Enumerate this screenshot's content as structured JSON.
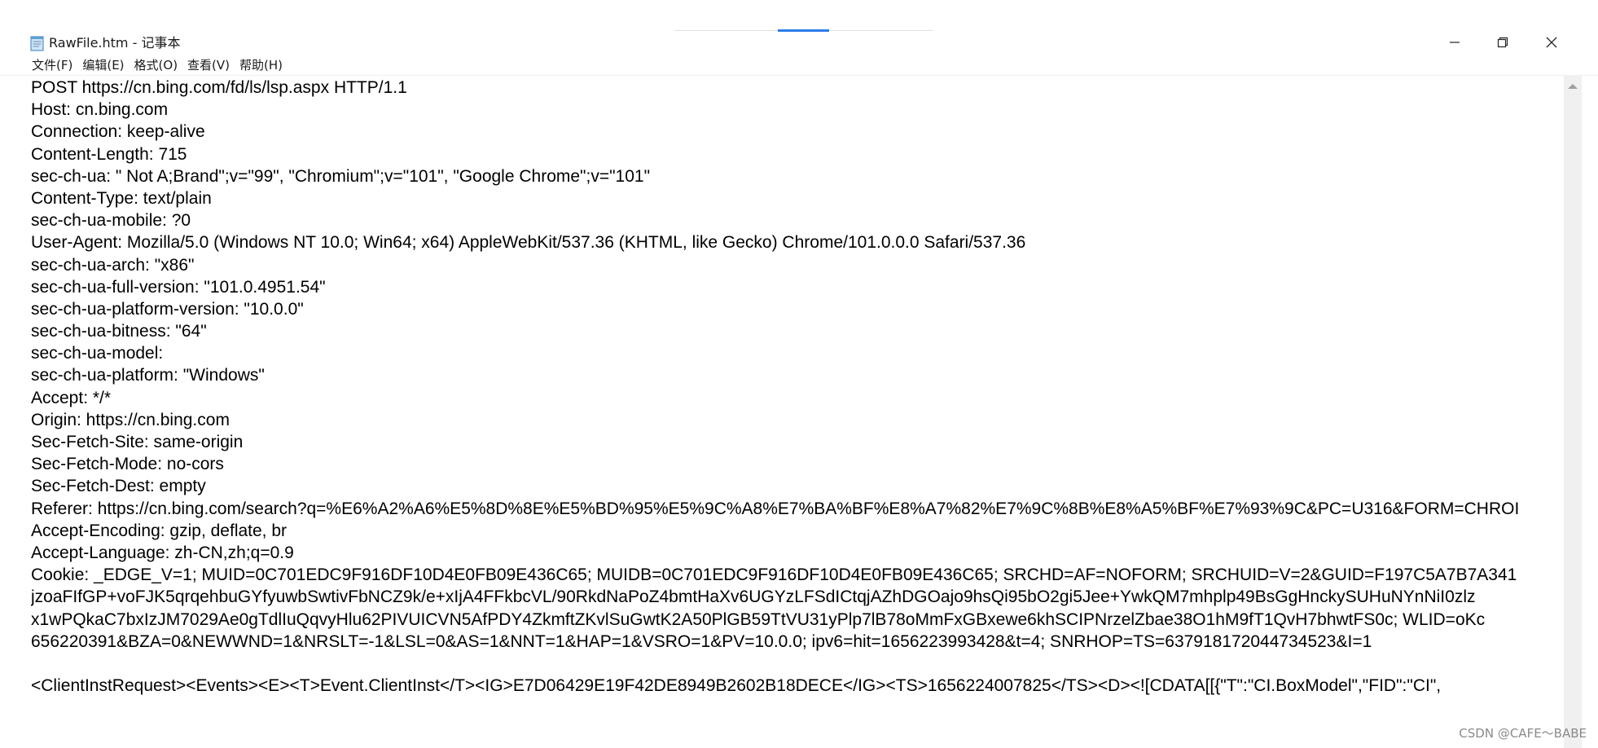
{
  "window": {
    "title": "RawFile.htm - 记事本",
    "icon": "notepad-icon"
  },
  "controls": {
    "minimize_icon": "minimize-icon",
    "maximize_icon": "restore-icon",
    "close_icon": "close-icon"
  },
  "menu": {
    "items": [
      {
        "label": "文件(F)"
      },
      {
        "label": "编辑(E)"
      },
      {
        "label": "格式(O)"
      },
      {
        "label": "查看(V)"
      },
      {
        "label": "帮助(H)"
      }
    ]
  },
  "document": {
    "lines": [
      "POST https://cn.bing.com/fd/ls/lsp.aspx HTTP/1.1",
      "Host: cn.bing.com",
      "Connection: keep-alive",
      "Content-Length: 715",
      "sec-ch-ua: \" Not A;Brand\";v=\"99\", \"Chromium\";v=\"101\", \"Google Chrome\";v=\"101\"",
      "Content-Type: text/plain",
      "sec-ch-ua-mobile: ?0",
      "User-Agent: Mozilla/5.0 (Windows NT 10.0; Win64; x64) AppleWebKit/537.36 (KHTML, like Gecko) Chrome/101.0.0.0 Safari/537.36",
      "sec-ch-ua-arch: \"x86\"",
      "sec-ch-ua-full-version: \"101.0.4951.54\"",
      "sec-ch-ua-platform-version: \"10.0.0\"",
      "sec-ch-ua-bitness: \"64\"",
      "sec-ch-ua-model:",
      "sec-ch-ua-platform: \"Windows\"",
      "Accept: */*",
      "Origin: https://cn.bing.com",
      "Sec-Fetch-Site: same-origin",
      "Sec-Fetch-Mode: no-cors",
      "Sec-Fetch-Dest: empty",
      "Referer: https://cn.bing.com/search?q=%E6%A2%A6%E5%8D%8E%E5%BD%95%E5%9C%A8%E7%BA%BF%E8%A7%82%E7%9C%8B%E8%A5%BF%E7%93%9C&PC=U316&FORM=CHROI",
      "Accept-Encoding: gzip, deflate, br",
      "Accept-Language: zh-CN,zh;q=0.9",
      "Cookie: _EDGE_V=1; MUID=0C701EDC9F916DF10D4E0FB09E436C65; MUIDB=0C701EDC9F916DF10D4E0FB09E436C65; SRCHD=AF=NOFORM; SRCHUID=V=2&GUID=F197C5A7B7A341",
      "jzoaFIfGP+voFJK5qrqehbuGYfyuwbSwtivFbNCZ9k/e+xIjA4FFkbcVL/90RkdNaPoZ4bmtHaXv6UGYzLFSdICtqjAZhDGOajo9hsQi95bO2gi5Jee+YwkQM7mhplp49BsGgHnckySUHuNYnNiI0zlz",
      "x1wPQkaC7bxIzJM7029Ae0gTdlIuQqvyHlu62PIVUICVN5AfPDY4ZkmftZKvlSuGwtK2A50PlGB59TtVU31yPlp7lB78oMmFxGBxewe6khSCIPNrzelZbae38O1hM9fT1QvH7bhwtFS0c; WLID=oKc",
      "656220391&BZA=0&NEWWND=1&NRSLT=-1&LSL=0&AS=1&NNT=1&HAP=1&VSRO=1&PV=10.0.0; ipv6=hit=1656223993428&t=4; SNRHOP=TS=637918172044734523&I=1",
      "",
      "<ClientInstRequest><Events><E><T>Event.ClientInst</T><IG>E7D06429E19F42DE8949B2602B18DECE</IG><TS>1656224007825</TS><D><![CDATA[[{\"T\":\"CI.BoxModel\",\"FID\":\"CI\","
    ]
  },
  "watermark": {
    "text": "CSDN @CAFE～BABE"
  }
}
